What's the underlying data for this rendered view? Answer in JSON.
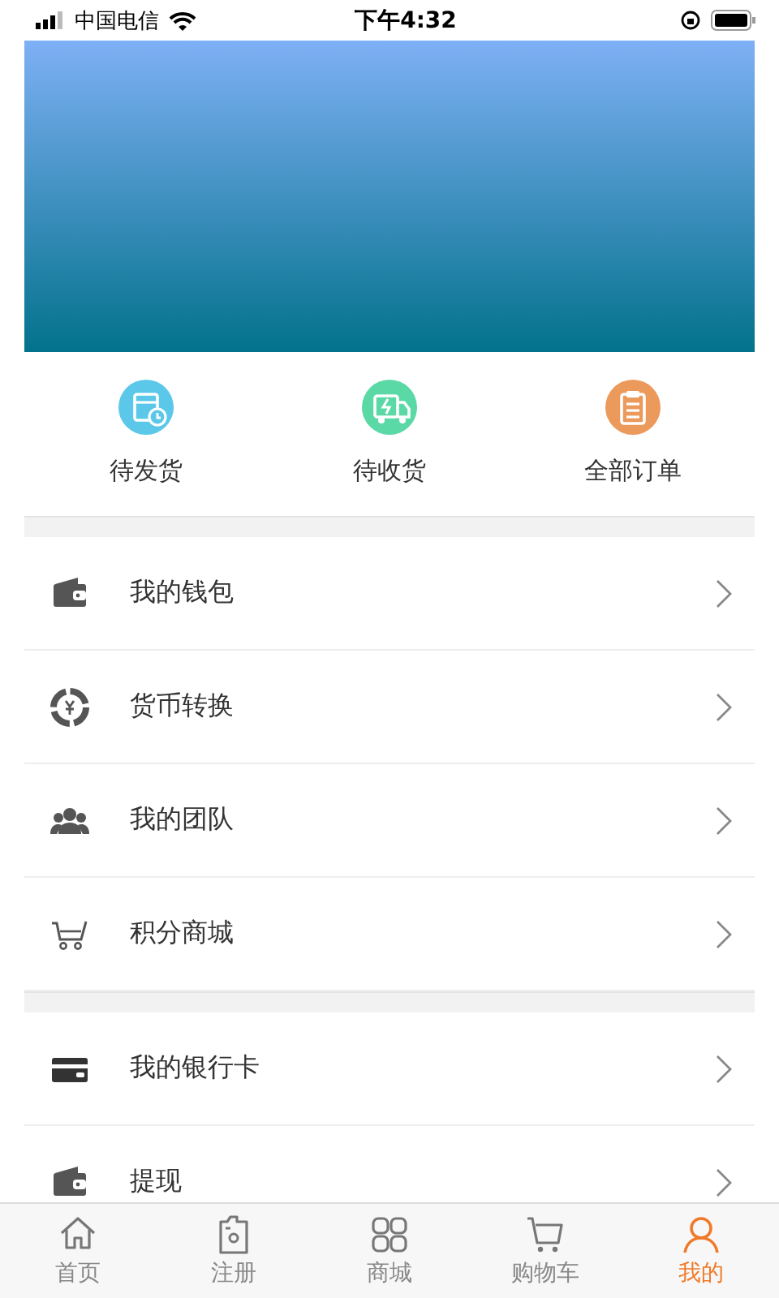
{
  "status_bar": {
    "carrier": "中国电信",
    "time": "下午4:32"
  },
  "orders": [
    {
      "label": "待发货",
      "kind": "pending-ship",
      "color": "#5bc8ea"
    },
    {
      "label": "待收货",
      "kind": "pending-receive",
      "color": "#5ad8a6"
    },
    {
      "label": "全部订单",
      "kind": "all-orders",
      "color": "#ec9a5c"
    }
  ],
  "menu_groups": [
    [
      {
        "label": "我的钱包",
        "kind": "wallet"
      },
      {
        "label": "货币转换",
        "kind": "currency"
      },
      {
        "label": "我的团队",
        "kind": "team"
      },
      {
        "label": "积分商城",
        "kind": "cart"
      }
    ],
    [
      {
        "label": "我的银行卡",
        "kind": "card"
      },
      {
        "label": "提现",
        "kind": "wallet"
      }
    ]
  ],
  "tab_bar": [
    {
      "label": "首页",
      "kind": "home",
      "selected": false
    },
    {
      "label": "注册",
      "kind": "camera",
      "selected": false
    },
    {
      "label": "商城",
      "kind": "grid",
      "selected": false
    },
    {
      "label": "购物车",
      "kind": "cart",
      "selected": false
    },
    {
      "label": "我的",
      "kind": "user",
      "selected": true
    }
  ]
}
